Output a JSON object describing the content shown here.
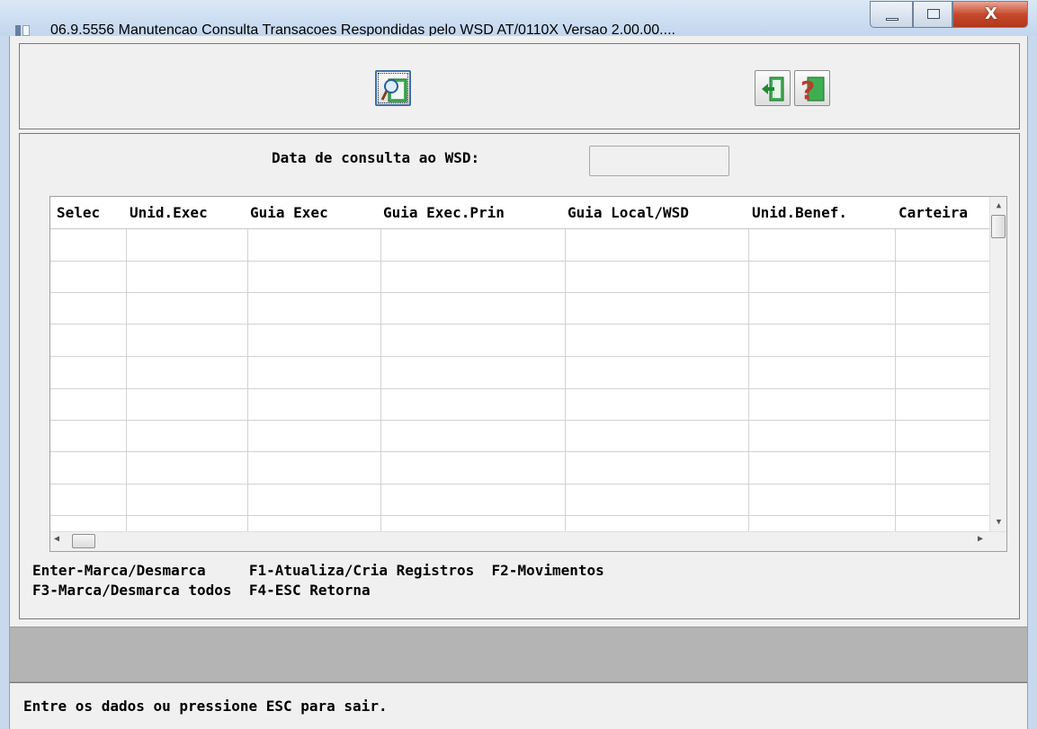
{
  "window": {
    "title": "06.9.5556 Manutencao  Consulta Transacoes Respondidas pelo WSD AT/0110X Versao 2.00.00....",
    "close_glyph": "X"
  },
  "toolbar": {
    "search_icon": "magnifier-icon",
    "exit_icon": "exit-door-icon",
    "help_icon": "help-question-icon"
  },
  "form": {
    "date_label": "Data de consulta ao WSD:",
    "date_value": ""
  },
  "grid": {
    "columns": [
      "Selec",
      "Unid.Exec",
      "Guia Exec",
      "Guia Exec.Prin",
      "Guia Local/WSD",
      "Unid.Benef.",
      "Carteira"
    ],
    "rows": []
  },
  "hints": {
    "line1": "Enter-Marca/Desmarca     F1-Atualiza/Cria Registros  F2-Movimentos",
    "line2": "F3-Marca/Desmarca todos  F4-ESC Retorna"
  },
  "status": {
    "message": "Entre os dados ou pressione ESC para sair."
  }
}
